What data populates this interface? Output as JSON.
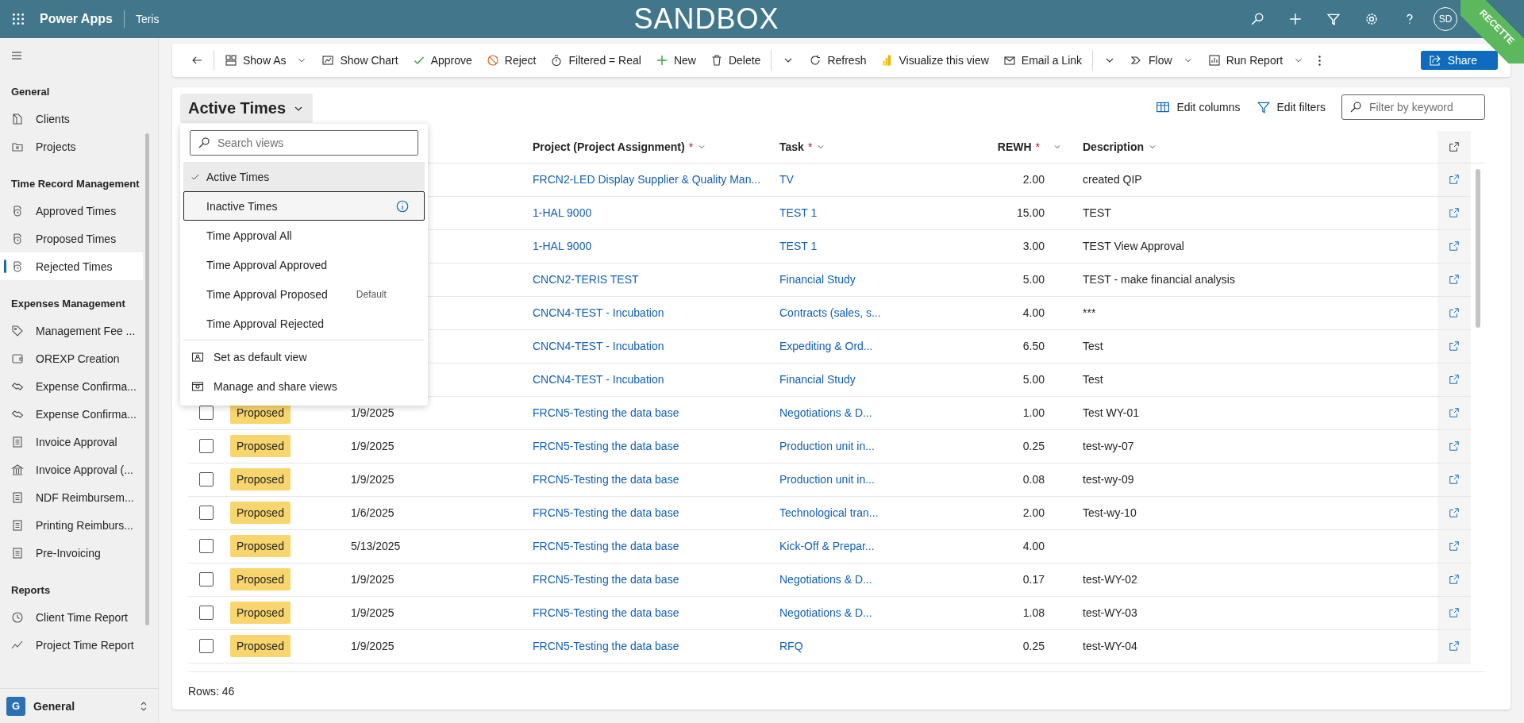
{
  "top_bar": {
    "app_name": "Power Apps",
    "environment": "Teris",
    "banner": "SANDBOX",
    "avatar": "SD",
    "ribbon": "RECETTE"
  },
  "sidebar": {
    "groups": [
      {
        "heading": "General",
        "items": [
          {
            "label": "Clients",
            "selected": false
          },
          {
            "label": "Projects",
            "selected": false
          }
        ]
      },
      {
        "heading": "Time Record Management",
        "items": [
          {
            "label": "Approved Times",
            "selected": false
          },
          {
            "label": "Proposed Times",
            "selected": false
          },
          {
            "label": "Rejected Times",
            "selected": true
          }
        ]
      },
      {
        "heading": "Expenses Management",
        "items": [
          {
            "label": "Management Fee ...",
            "selected": false
          },
          {
            "label": "OREXP Creation",
            "selected": false
          },
          {
            "label": "Expense Confirma...",
            "selected": false
          },
          {
            "label": "Expense Confirma...",
            "selected": false
          },
          {
            "label": "Invoice Approval",
            "selected": false
          },
          {
            "label": "Invoice Approval (...",
            "selected": false
          },
          {
            "label": "NDF Reimbursem...",
            "selected": false
          },
          {
            "label": "Printing Reimburs...",
            "selected": false
          },
          {
            "label": "Pre-Invoicing",
            "selected": false
          }
        ]
      },
      {
        "heading": "Reports",
        "items": [
          {
            "label": "Client Time Report",
            "selected": false
          },
          {
            "label": "Project Time Report",
            "selected": false
          }
        ]
      }
    ],
    "footer": {
      "badge": "G",
      "label": "General"
    }
  },
  "toolbar": [
    {
      "kind": "back"
    },
    {
      "kind": "divider"
    },
    {
      "kind": "command",
      "label": "Show As",
      "menu": true
    },
    {
      "kind": "command",
      "label": "Show Chart",
      "menu": false
    },
    {
      "kind": "command",
      "label": "Approve",
      "menu": false
    },
    {
      "kind": "command",
      "label": "Reject",
      "menu": false
    },
    {
      "kind": "command",
      "label": "Filtered = Real",
      "menu": false
    },
    {
      "kind": "command",
      "label": "New",
      "menu": false
    },
    {
      "kind": "command",
      "label": "Delete",
      "menu": false
    },
    {
      "kind": "divider"
    },
    {
      "kind": "caret"
    },
    {
      "kind": "command",
      "label": "Refresh",
      "menu": false
    },
    {
      "kind": "command",
      "label": "Visualize this view",
      "menu": false
    },
    {
      "kind": "command",
      "label": "Email a Link",
      "menu": false
    },
    {
      "kind": "divider"
    },
    {
      "kind": "caret"
    },
    {
      "kind": "command",
      "label": "Flow",
      "menu": true
    },
    {
      "kind": "command",
      "label": "Run Report",
      "menu": true
    },
    {
      "kind": "overflow"
    },
    {
      "kind": "primary",
      "label": "Share"
    }
  ],
  "view": {
    "title": "Active Times",
    "actions": [
      "Edit columns",
      "Edit filters"
    ],
    "filter": {
      "placeholder": "Filter by keyword"
    }
  },
  "view_menu": {
    "search": {
      "placeholder": "Search views"
    },
    "views": [
      {
        "label": "Active Times",
        "selected": true,
        "focused": false
      },
      {
        "label": "Inactive Times",
        "selected": false,
        "focused": true
      },
      {
        "label": "Time Approval All",
        "selected": false,
        "focused": false
      },
      {
        "label": "Time Approval Approved",
        "selected": false,
        "focused": false
      },
      {
        "label": "Time Approval Proposed",
        "selected": false,
        "focused": false,
        "badge": "Default"
      },
      {
        "label": "Time Approval Rejected",
        "selected": false,
        "focused": false
      }
    ],
    "actions": [
      "Set as default view",
      "Manage and share views"
    ]
  },
  "table": {
    "columns": [
      {
        "label": "Project (Project Assignment)",
        "mark": "*"
      },
      {
        "label": "Task",
        "mark": "*"
      },
      {
        "label": "REWH",
        "mark": "*"
      },
      {
        "label": "Description"
      }
    ],
    "rows": [
      {
        "project": "FRCN2-LED Display Supplier & Quality Man...",
        "task": "TV",
        "rewh": "2.00",
        "description": "created QIP"
      },
      {
        "project": "1-HAL 9000",
        "task": "TEST 1",
        "rewh": "15.00",
        "description": "TEST"
      },
      {
        "project": "1-HAL 9000",
        "task": "TEST 1",
        "rewh": "3.00",
        "description": "TEST View Approval"
      },
      {
        "project": "CNCN2-TERIS TEST",
        "task": "Financial Study",
        "rewh": "5.00",
        "description": "TEST - make financial analysis"
      },
      {
        "project": "CNCN4-TEST - Incubation",
        "task": "Contracts (sales, s...",
        "rewh": "4.00",
        "description": "***"
      },
      {
        "project": "CNCN4-TEST - Incubation",
        "task": "Expediting & Ord...",
        "rewh": "6.50",
        "description": "Test"
      },
      {
        "project": "CNCN4-TEST - Incubation",
        "task": "Financial Study",
        "rewh": "5.00",
        "description": "Test"
      },
      {
        "checked": false,
        "status": "Proposed",
        "date": "1/9/2025",
        "project": "FRCN5-Testing the data base",
        "task": "Negotiations & D...",
        "rewh": "1.00",
        "description": "Test WY-01"
      },
      {
        "checked": false,
        "status": "Proposed",
        "date": "1/9/2025",
        "project": "FRCN5-Testing the data base",
        "task": "Production unit in...",
        "rewh": "0.25",
        "description": "test-wy-07"
      },
      {
        "checked": false,
        "status": "Proposed",
        "date": "1/9/2025",
        "project": "FRCN5-Testing the data base",
        "task": "Production unit in...",
        "rewh": "0.08",
        "description": "test-wy-09"
      },
      {
        "checked": false,
        "status": "Proposed",
        "date": "1/6/2025",
        "project": "FRCN5-Testing the data base",
        "task": "Technological tran...",
        "rewh": "2.00",
        "description": "Test-wy-10"
      },
      {
        "checked": false,
        "status": "Proposed",
        "date": "5/13/2025",
        "project": "FRCN5-Testing the data base",
        "task": "Kick-Off & Prepar...",
        "rewh": "4.00"
      },
      {
        "checked": false,
        "status": "Proposed",
        "date": "1/9/2025",
        "project": "FRCN5-Testing the data base",
        "task": "Negotiations & D...",
        "rewh": "0.17",
        "description": "test-WY-02"
      },
      {
        "checked": false,
        "status": "Proposed",
        "date": "1/9/2025",
        "project": "FRCN5-Testing the data base",
        "task": "Negotiations & D...",
        "rewh": "1.08",
        "description": "test-WY-03"
      },
      {
        "checked": false,
        "status": "Proposed",
        "date": "1/9/2025",
        "project": "FRCN5-Testing the data base",
        "task": "RFQ",
        "rewh": "0.25",
        "description": "test-WY-04"
      }
    ],
    "footer": "Rows: 46"
  }
}
